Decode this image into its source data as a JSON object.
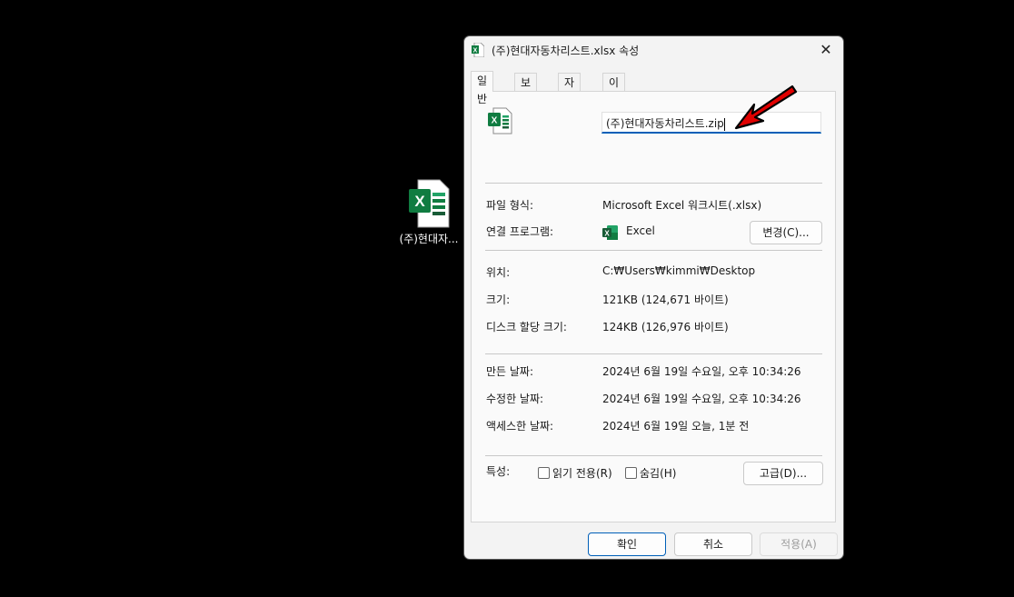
{
  "desktop": {
    "icon_label": "(주)현대자..."
  },
  "dialog": {
    "title": "(주)현대자동차리스트.xlsx 속성",
    "close_glyph": "✕",
    "tabs": [
      "일반",
      "보안",
      "자세히",
      "이전 버전"
    ],
    "filename": "(주)현대자동차리스트.zip",
    "rows": {
      "filetype_label": "파일 형식:",
      "filetype_value": "Microsoft Excel 워크시트(.xlsx)",
      "openwith_label": "연결 프로그램:",
      "openwith_value": "Excel",
      "change_button": "변경(C)...",
      "location_label": "위치:",
      "location_value": "C:₩Users₩kimmi₩Desktop",
      "size_label": "크기:",
      "size_value": "121KB (124,671 바이트)",
      "disksize_label": "디스크 할당 크기:",
      "disksize_value": "124KB (126,976 바이트)",
      "created_label": "만든 날짜:",
      "created_value": "2024년 6월 19일 수요일, 오후 10:34:26",
      "modified_label": "수정한 날짜:",
      "modified_value": "2024년 6월 19일 수요일, 오후 10:34:26",
      "accessed_label": "액세스한 날짜:",
      "accessed_value": "2024년 6월 19일 오늘, 1분 전",
      "attributes_label": "특성:",
      "readonly_label": "읽기 전용(R)",
      "hidden_label": "숨김(H)",
      "advanced_button": "고급(D)..."
    },
    "footer": {
      "ok": "확인",
      "cancel": "취소",
      "apply": "적용(A)"
    }
  },
  "colors": {
    "accent": "#005fb8",
    "excel_green": "#107c41",
    "arrow_red": "#e00000"
  }
}
